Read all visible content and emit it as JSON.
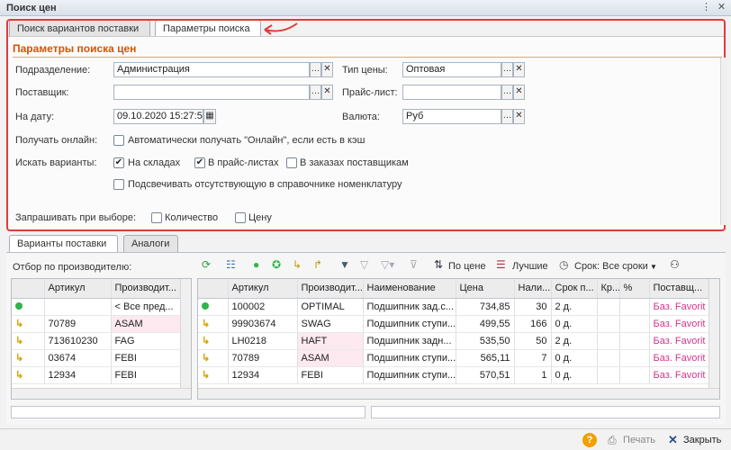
{
  "window": {
    "title": "Поиск цен"
  },
  "tabs_top": [
    {
      "label": "Поиск вариантов поставки"
    },
    {
      "label": "Параметры поиска"
    }
  ],
  "params": {
    "section_title": "Параметры поиска цен",
    "division_label": "Подразделение:",
    "division_value": "Администрация",
    "supplier_label": "Поставщик:",
    "supplier_value": "",
    "date_label": "На дату:",
    "date_value": "09.10.2020 15:27:5",
    "price_type_label": "Тип цены:",
    "price_type_value": "Оптовая",
    "pricelist_label": "Прайс-лист:",
    "pricelist_value": "",
    "currency_label": "Валюта:",
    "currency_value": "Руб",
    "online_label": "Получать онлайн:",
    "online_checkbox": "Автоматически получать \"Онлайн\", если есть в кэш",
    "search_label": "Искать варианты:",
    "in_stock": "На складах",
    "in_pricelists": "В прайс-листах",
    "in_orders": "В заказах поставщикам",
    "highlight_missing": "Подсвечивать отсутствующую в справочнике номенклатуру",
    "ask_label": "Запрашивать при выборе:",
    "ask_quantity": "Количество",
    "ask_price": "Цену"
  },
  "tabs_bottom": [
    {
      "label": "Варианты поставки"
    },
    {
      "label": "Аналоги"
    }
  ],
  "filter_label": "Отбор по производителю:",
  "toolbar": {
    "by_price": "По цене",
    "best": "Лучшие",
    "term": "Срок: Все сроки"
  },
  "left_grid": {
    "columns": [
      "Артикул",
      "Производит..."
    ],
    "rows": [
      {
        "icon": "dot",
        "article": "",
        "maker": "< Все пред..."
      },
      {
        "icon": "arrow",
        "article": "70789",
        "maker": "ASAM"
      },
      {
        "icon": "arrow",
        "article": "713610230",
        "maker": "FAG"
      },
      {
        "icon": "arrow",
        "article": "03674",
        "maker": "FEBI"
      },
      {
        "icon": "arrow",
        "article": "12934",
        "maker": "FEBI"
      }
    ]
  },
  "right_grid": {
    "columns": [
      "Артикул",
      "Производит...",
      "Наименование",
      "Цена",
      "Нали...",
      "Срок п...",
      "Кр...",
      "%",
      "Поставщ..."
    ],
    "rows": [
      {
        "icon": "dot",
        "article": "100002",
        "maker": "OPTIMAL",
        "name": "Подшипник зад.с...",
        "price": "734,85",
        "qty": "30",
        "term": "2 д.",
        "kr": "",
        "pct": "",
        "supplier": "Баз. Favorit"
      },
      {
        "icon": "arrow",
        "article": "99903674",
        "maker": "SWAG",
        "name": "Подшипник ступи...",
        "price": "499,55",
        "qty": "166",
        "term": "0 д.",
        "kr": "",
        "pct": "",
        "supplier": "Баз. Favorit"
      },
      {
        "icon": "arrow",
        "article": "LH0218",
        "maker": "HAFT",
        "name": "Подшипник задн...",
        "price": "535,50",
        "qty": "50",
        "term": "2 д.",
        "kr": "",
        "pct": "",
        "supplier": "Баз. Favorit"
      },
      {
        "icon": "arrow",
        "article": "70789",
        "maker": "ASAM",
        "name": "Подшипник ступи...",
        "price": "565,11",
        "qty": "7",
        "term": "0 д.",
        "kr": "",
        "pct": "",
        "supplier": "Баз. Favorit"
      },
      {
        "icon": "arrow",
        "article": "12934",
        "maker": "FEBI",
        "name": "Подшипник ступи...",
        "price": "570,51",
        "qty": "1",
        "term": "0 д.",
        "kr": "",
        "pct": "",
        "supplier": "Баз. Favorit"
      }
    ]
  },
  "footer": {
    "help": "?",
    "print": "Печать",
    "close": "Закрыть"
  },
  "colors": {
    "accent_red": "#e03c3c",
    "section_orange": "#d35400",
    "supplier_pink": "#d6348a",
    "dot_green": "#2fb54a"
  }
}
